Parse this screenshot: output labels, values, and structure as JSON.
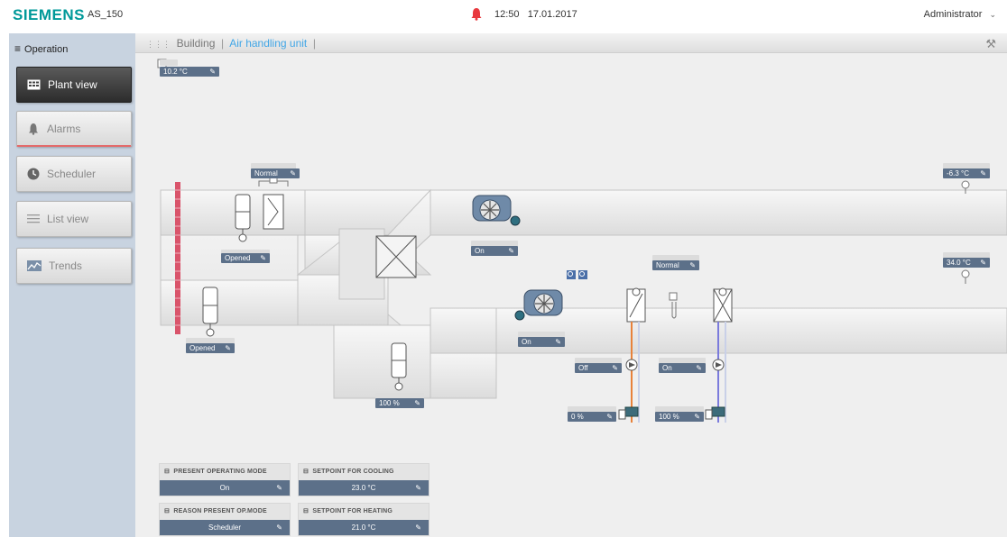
{
  "header": {
    "brand": "SIEMENS",
    "device": "AS_150",
    "time": "12:50",
    "date": "17.01.2017",
    "user": "Administrator"
  },
  "sidebar": {
    "heading": "Operation",
    "items": [
      {
        "label": "Plant view"
      },
      {
        "label": "Alarms"
      },
      {
        "label": "Scheduler"
      },
      {
        "label": "List view"
      },
      {
        "label": "Trends"
      }
    ]
  },
  "breadcrumb": {
    "items": [
      "Building",
      "Air handling unit"
    ]
  },
  "plant": {
    "outside_temp": "10.2 °C",
    "damper_mode": "Normal",
    "exhaust_temp": "-6.3 °C",
    "supply_temp": "34.0 °C",
    "exhaust_damper": "Opened",
    "exhaust_fan": "On",
    "outdoor_damper": "Opened",
    "supply_fan": "On",
    "mixing_damper": "100 %",
    "heat_mode": "Normal",
    "heating_pump": "Off",
    "cooling_pump": "On",
    "heating_valve": "0 %",
    "cooling_valve": "100 %"
  },
  "panels": {
    "present_mode_title": "PRESENT OPERATING MODE",
    "present_mode_value": "On",
    "reason_title": "REASON PRESENT OP.MODE",
    "reason_value": "Scheduler",
    "cooling_title": "SETPOINT FOR COOLING",
    "cooling_value": "23.0 °C",
    "heating_title": "SETPOINT FOR HEATING",
    "heating_value": "21.0 °C"
  },
  "colors": {
    "brand": "#009999",
    "accent": "#41a6e6",
    "widget": "#5c7089",
    "alarm": "#e8383d",
    "heating_pipe": "#e8823b",
    "cooling_pipe": "#7b7bdc"
  }
}
